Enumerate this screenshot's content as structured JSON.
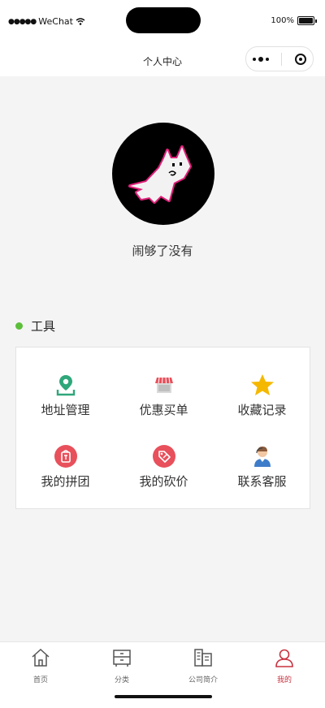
{
  "status_bar": {
    "carrier": "WeChat",
    "battery": "100%"
  },
  "nav": {
    "title": "个人中心"
  },
  "profile": {
    "username": "闹够了没有"
  },
  "tools": {
    "section_title": "工具",
    "items": [
      {
        "label": "地址管理",
        "icon": "location-icon"
      },
      {
        "label": "优惠买单",
        "icon": "shop-icon"
      },
      {
        "label": "收藏记录",
        "icon": "star-icon"
      },
      {
        "label": "我的拼团",
        "icon": "group-buy-icon"
      },
      {
        "label": "我的砍价",
        "icon": "bargain-tag-icon"
      },
      {
        "label": "联系客服",
        "icon": "customer-service-icon"
      }
    ]
  },
  "tabbar": {
    "items": [
      {
        "label": "首页",
        "icon": "home-icon"
      },
      {
        "label": "分类",
        "icon": "category-icon"
      },
      {
        "label": "公司简介",
        "icon": "company-icon"
      },
      {
        "label": "我的",
        "icon": "user-icon",
        "active": true
      }
    ],
    "active_color": "#c8323f"
  },
  "colors": {
    "section_dot": "#5cbf3a",
    "location": "#2fa77a",
    "star": "#f5b800",
    "badge_red": "#e8505b"
  }
}
